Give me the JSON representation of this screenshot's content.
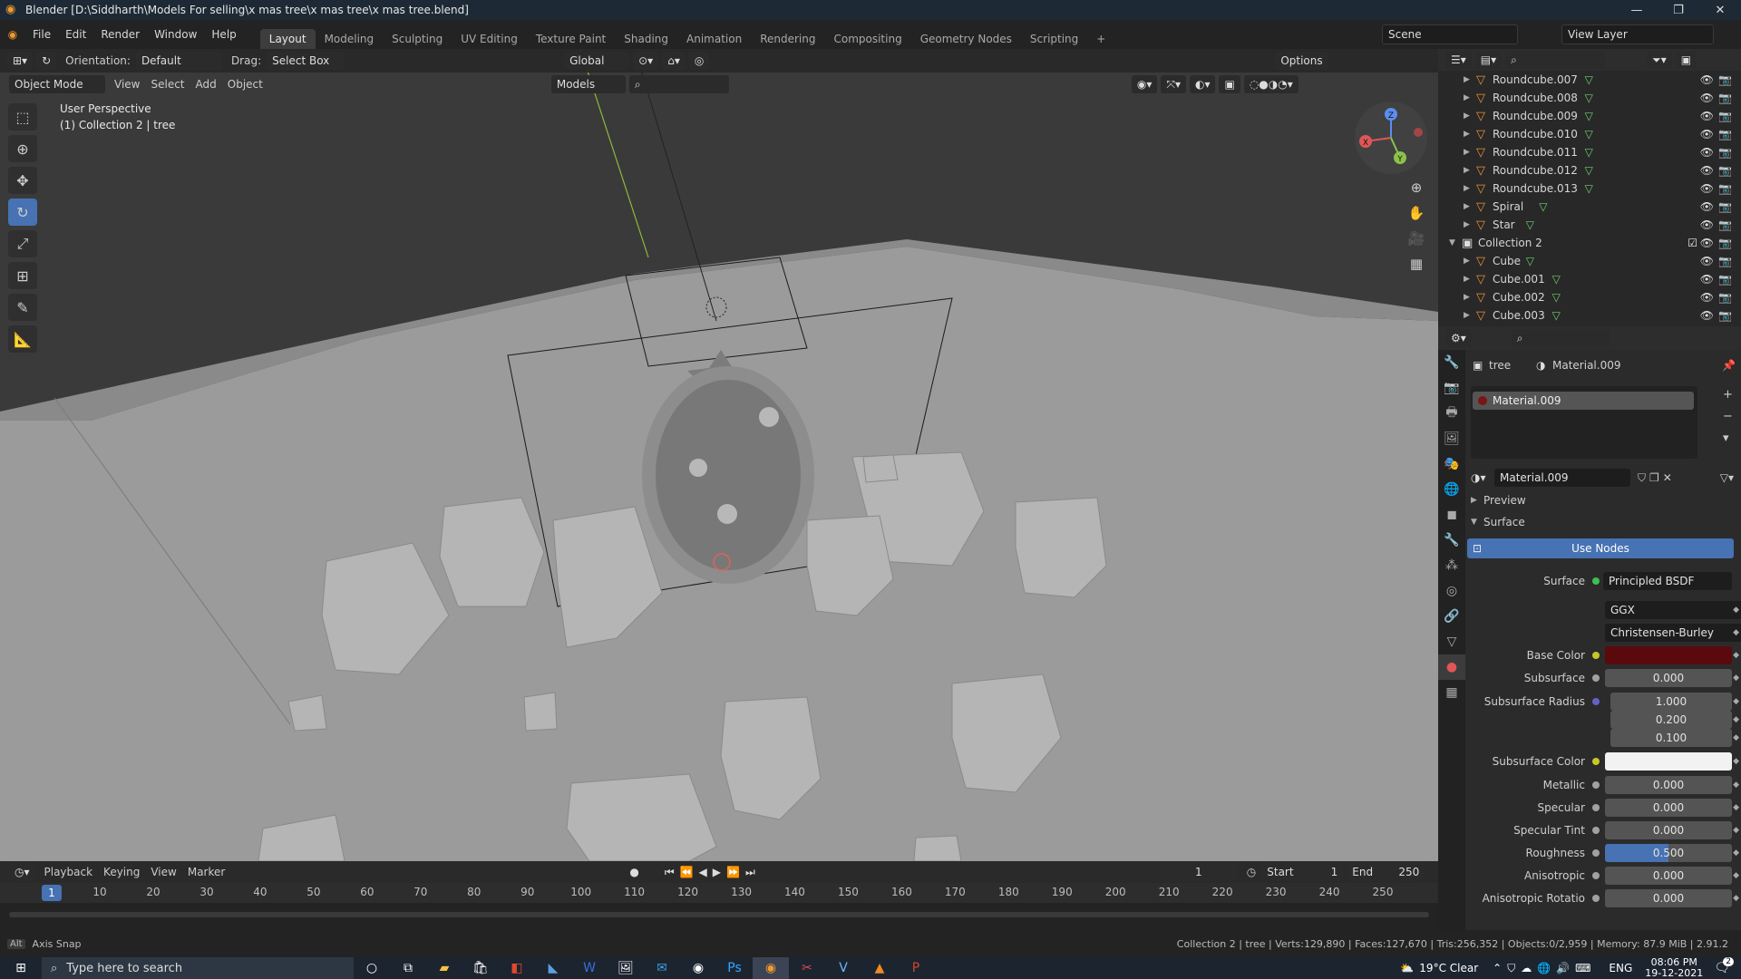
{
  "window": {
    "title": "Blender [D:\\Siddharth\\Models For selling\\x mas tree\\x mas tree\\x mas tree.blend]"
  },
  "menu": [
    "File",
    "Edit",
    "Render",
    "Window",
    "Help"
  ],
  "workspaces": [
    "Layout",
    "Modeling",
    "Sculpting",
    "UV Editing",
    "Texture Paint",
    "Shading",
    "Animation",
    "Rendering",
    "Compositing",
    "Geometry Nodes",
    "Scripting"
  ],
  "active_workspace": "Layout",
  "scene": "Scene",
  "view_layer": "View Layer",
  "viewport": {
    "orientation_label": "Orientation:",
    "orientation_value": "Default",
    "drag_label": "Drag:",
    "drag_value": "Select Box",
    "transform_orientation": "Global",
    "options_label": "Options",
    "mode": "Object Mode",
    "menus": [
      "View",
      "Select",
      "Add",
      "Object"
    ],
    "collection_filter": "Models",
    "info_line1": "User Perspective",
    "info_line2": "(1) Collection 2 | tree"
  },
  "gizmo": {
    "x": "X",
    "y": "Y",
    "z": "Z"
  },
  "outliner": {
    "rows": [
      {
        "name": "Roundcube.007",
        "type": "object"
      },
      {
        "name": "Roundcube.008",
        "type": "object"
      },
      {
        "name": "Roundcube.009",
        "type": "object"
      },
      {
        "name": "Roundcube.010",
        "type": "object"
      },
      {
        "name": "Roundcube.011",
        "type": "object"
      },
      {
        "name": "Roundcube.012",
        "type": "object"
      },
      {
        "name": "Roundcube.013",
        "type": "object"
      },
      {
        "name": "Spiral",
        "type": "object"
      },
      {
        "name": "Star",
        "type": "object"
      },
      {
        "name": "Collection 2",
        "type": "collection"
      },
      {
        "name": "Cube",
        "type": "object"
      },
      {
        "name": "Cube.001",
        "type": "object"
      },
      {
        "name": "Cube.002",
        "type": "object"
      },
      {
        "name": "Cube.003",
        "type": "object"
      }
    ]
  },
  "properties": {
    "breadcrumb_object": "tree",
    "breadcrumb_material": "Material.009",
    "slot": "Material.009",
    "material_name": "Material.009",
    "preview_label": "Preview",
    "surface_label": "Surface",
    "use_nodes": "Use Nodes",
    "surface_field_label": "Surface",
    "surface_value": "Principled BSDF",
    "distribution": "GGX",
    "subsurface_method": "Christensen-Burley",
    "base_color_label": "Base Color",
    "base_color": "#5a0a0c",
    "subsurface_color": "#f2f2f2",
    "fields": [
      {
        "label": "Subsurface",
        "value": "0.000"
      },
      {
        "label": "Subsurface Radius",
        "value": "1.000"
      },
      {
        "label": "",
        "value": "0.200"
      },
      {
        "label": "",
        "value": "0.100"
      },
      {
        "label": "Subsurface Color",
        "value": ""
      },
      {
        "label": "Metallic",
        "value": "0.000"
      },
      {
        "label": "Specular",
        "value": "0.000"
      },
      {
        "label": "Specular Tint",
        "value": "0.000"
      },
      {
        "label": "Roughness",
        "value": "0.500",
        "fill": 0.5
      },
      {
        "label": "Anisotropic",
        "value": "0.000"
      },
      {
        "label": "Anisotropic Rotatio",
        "value": "0.000"
      }
    ]
  },
  "timeline": {
    "menus": [
      "Playback",
      "Keying",
      "View",
      "Marker"
    ],
    "current_frame": "1",
    "start_label": "Start",
    "start": "1",
    "end_label": "End",
    "end": "250",
    "ruler": [
      "1",
      "10",
      "20",
      "30",
      "40",
      "50",
      "60",
      "70",
      "80",
      "90",
      "100",
      "110",
      "120",
      "130",
      "140",
      "150",
      "160",
      "170",
      "180",
      "190",
      "200",
      "210",
      "220",
      "230",
      "240",
      "250"
    ]
  },
  "status": {
    "left": "Axis Snap",
    "right": "Collection 2 | tree | Verts:129,890 | Faces:127,670 | Tris:256,352 | Objects:0/2,959 | Memory: 87.9 MiB | 2.91.2"
  },
  "taskbar": {
    "search": "Type here to search",
    "weather": "19°C  Clear",
    "lang": "ENG",
    "time": "08:06 PM",
    "date": "19-12-2021",
    "notif_count": "2"
  }
}
